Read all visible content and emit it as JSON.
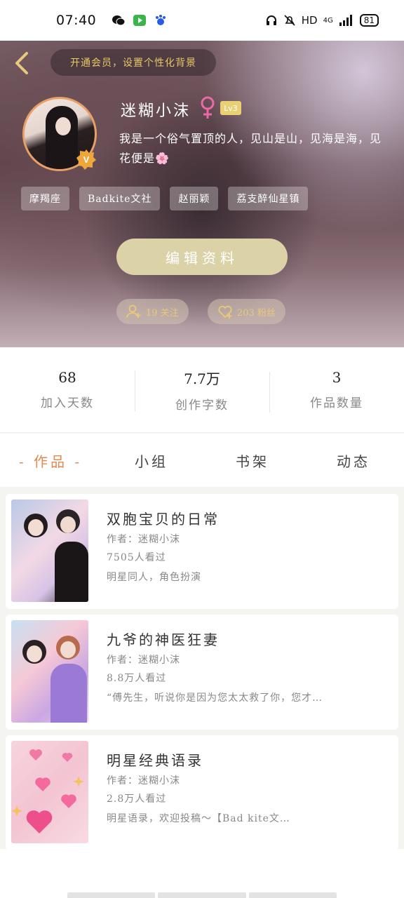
{
  "status_bar": {
    "time": "07:40",
    "network": "HD",
    "signal": "4G",
    "battery": "81"
  },
  "header": {
    "vip_banner": "开通会员，设置个性化背景",
    "username": "迷糊小沫",
    "level": "Lv3",
    "bio": "我是一个俗气置顶的人，见山是山，见海是海，见花便是🌸",
    "tags": [
      "摩羯座",
      "Badkite文社",
      "赵丽颖",
      "荔支醉仙星镇"
    ],
    "edit_button": "编辑资料",
    "following": "19 关注",
    "followers": "203 粉丝"
  },
  "stats": [
    {
      "value": "68",
      "label": "加入天数"
    },
    {
      "value": "7.7万",
      "label": "创作字数"
    },
    {
      "value": "3",
      "label": "作品数量"
    }
  ],
  "tabs": [
    "- 作品 -",
    "小组",
    "书架",
    "动态"
  ],
  "works": [
    {
      "title": "双胞宝贝的日常",
      "author": "作者：迷糊小沫",
      "views": "7505人看过",
      "desc": "明星同人，角色扮演"
    },
    {
      "title": "九爷的神医狂妻",
      "author": "作者：迷糊小沫",
      "views": "8.8万人看过",
      "desc": "“傅先生，听说你是因为您太太救了你，您才…"
    },
    {
      "title": "明星经典语录",
      "author": "作者：迷糊小沫",
      "views": "2.8万人看过",
      "desc": "明星语录，欢迎投稿～【Bad kite文…"
    }
  ],
  "colors": {
    "accent_orange": "#e48a4c",
    "gold": "#e8c97b",
    "button_beige": "#dcd2a8"
  },
  "icons": [
    "back-arrow-icon",
    "female-icon",
    "verified-v-icon",
    "add-user-icon",
    "heart-plus-icon"
  ]
}
